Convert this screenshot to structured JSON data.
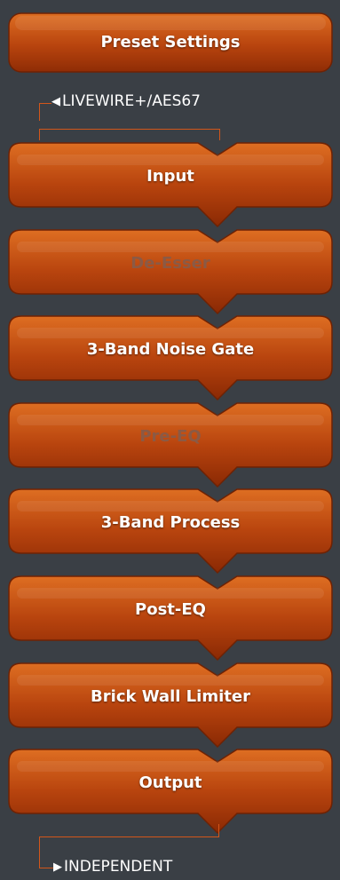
{
  "preset": {
    "label": "Preset Settings"
  },
  "input_routing": {
    "arrow": "◀",
    "label": "LIVEWIRE+/AES67"
  },
  "output_routing": {
    "arrow": "▶",
    "label": "INDEPENDENT"
  },
  "blocks": [
    {
      "id": "input",
      "label": "Input",
      "enabled": true
    },
    {
      "id": "de-esser",
      "label": "De-Esser",
      "enabled": false
    },
    {
      "id": "3-band-noise-gate",
      "label": "3-Band Noise Gate",
      "enabled": true
    },
    {
      "id": "pre-eq",
      "label": "Pre-EQ",
      "enabled": false
    },
    {
      "id": "3-band-process",
      "label": "3-Band Process",
      "enabled": true
    },
    {
      "id": "post-eq",
      "label": "Post-EQ",
      "enabled": true
    },
    {
      "id": "brick-wall-limiter",
      "label": "Brick Wall Limiter",
      "enabled": true
    },
    {
      "id": "output",
      "label": "Output",
      "enabled": true
    }
  ],
  "colors": {
    "background": "#3a3f45",
    "tile_top": "#dc6a1c",
    "tile_bottom": "#8f2c05",
    "tile_border": "#6e2204",
    "label_enabled": "#ffffff",
    "label_disabled": "#8b5a45",
    "route_line": "#d2561a"
  }
}
